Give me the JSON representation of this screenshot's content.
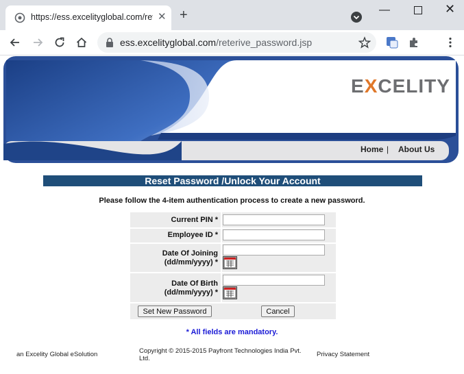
{
  "browser": {
    "tab_title": "https://ess.excelityglobal.com/reterive_password.jsp",
    "url_host": "ess.excelityglobal.com",
    "url_path": "/reterive_password.jsp",
    "new_tab": "+",
    "close_tab": "✕"
  },
  "header": {
    "logo_pre": "E",
    "logo_x": "X",
    "logo_post": "CELITY",
    "nav": {
      "home": "Home",
      "separator": "|",
      "about": "About Us"
    }
  },
  "page": {
    "title": "Reset Password /Unlock Your Account",
    "instructions": "Please follow the 4-item authentication process to create a new password.",
    "mandatory_note": "* All fields are mandatory."
  },
  "form": {
    "current_pin_label": "Current PIN *",
    "employee_id_label": "Employee ID *",
    "doj_label_1": "Date Of Joining",
    "doj_label_2": "(dd/mm/yyyy) *",
    "dob_label_1": "Date Of Birth",
    "dob_label_2": "(dd/mm/yyyy) *",
    "current_pin_value": "",
    "employee_id_value": "",
    "doj_value": "",
    "dob_value": "",
    "set_password_button": "Set New Password",
    "cancel_button": "Cancel"
  },
  "footer": {
    "brand": "an Excelity Global eSolution",
    "copyright_1": "Copyright © 2015-2015 Payfront Technologies India Pvt.",
    "copyright_2": "Ltd.",
    "privacy": "Privacy Statement"
  },
  "colors": {
    "title_bar": "#1f4e79",
    "banner_blue": "#2f5fa8",
    "mandatory_text": "#1a1ad6",
    "logo_accent": "#e0782a",
    "logo_grey": "#6d6e71"
  }
}
